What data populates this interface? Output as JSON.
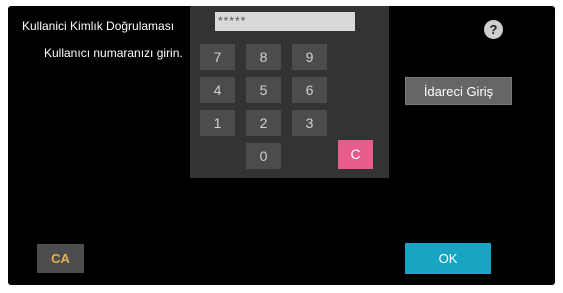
{
  "screen": {
    "title": "Kullanici Kimlık Doğrulaması",
    "subtitle": "Kullanıcı numaranızı girin.",
    "help_label": "?"
  },
  "keypad": {
    "pin_value": "*****",
    "keys": [
      "7",
      "8",
      "9",
      "4",
      "5",
      "6",
      "1",
      "2",
      "3",
      "0"
    ],
    "clear_label": "C",
    "clear_color": "#e85b8d"
  },
  "buttons": {
    "admin_login": "İdareci Giriş",
    "ca": "CA",
    "ok": "OK",
    "ok_color": "#19a4c4"
  }
}
